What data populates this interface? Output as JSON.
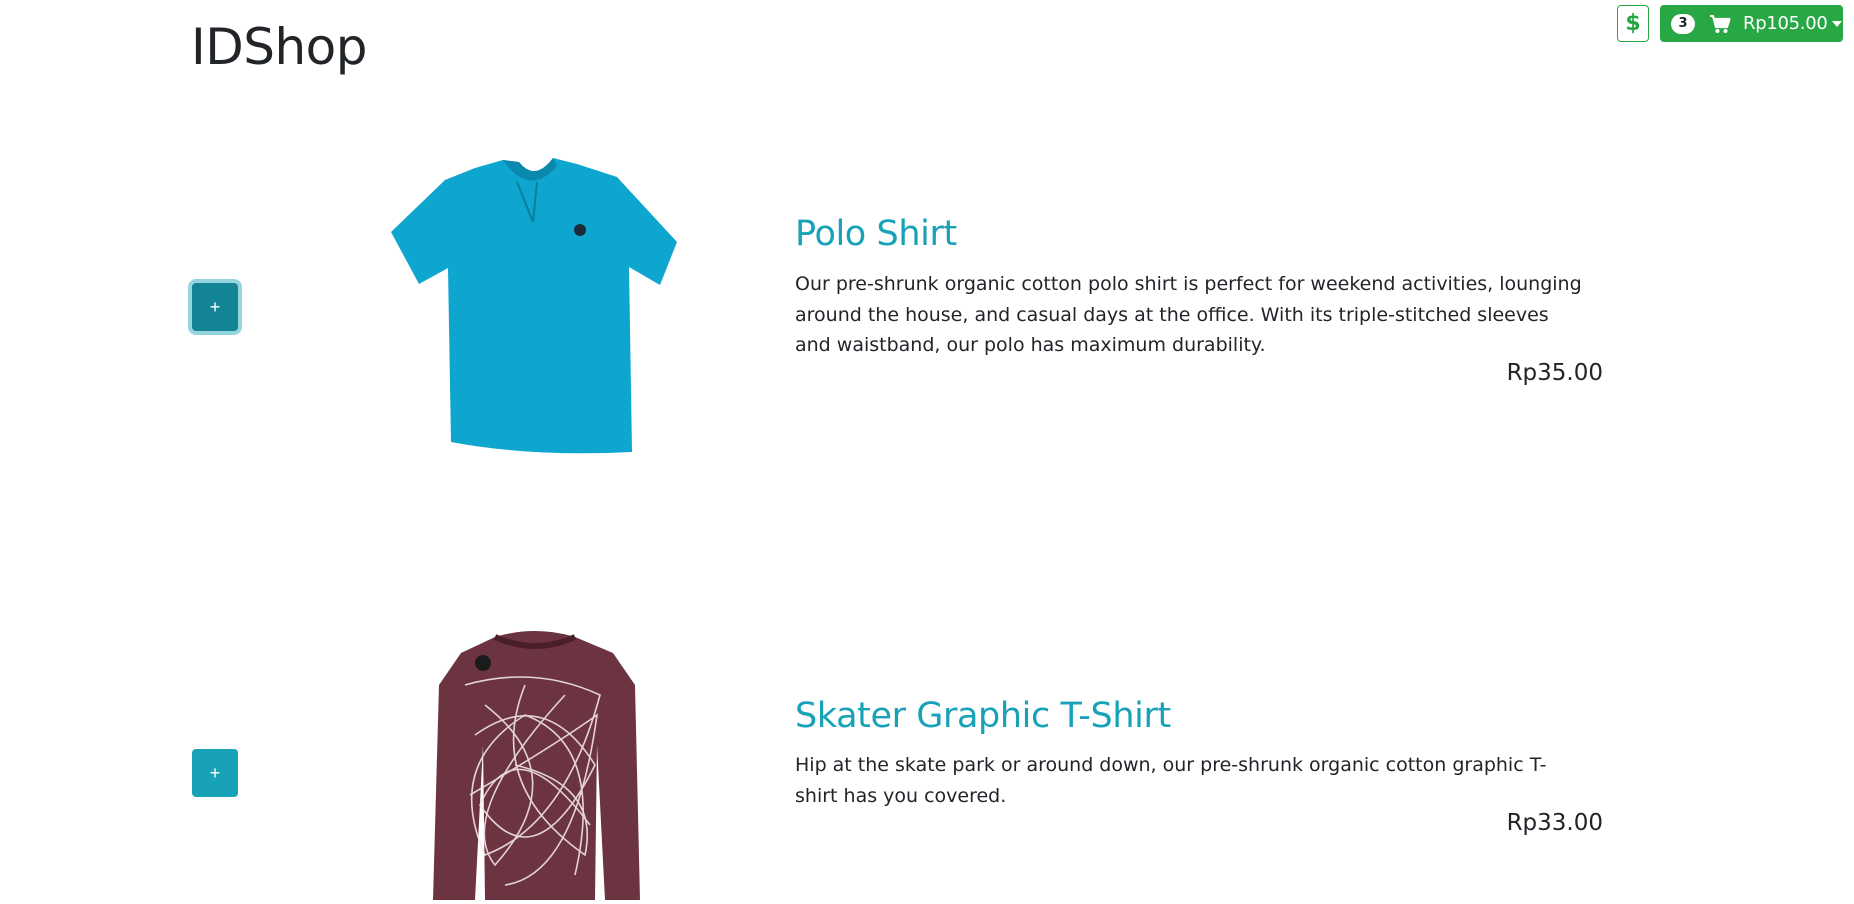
{
  "app": {
    "title": "IDShop"
  },
  "header": {
    "currency_icon": "$",
    "cart": {
      "count": "3",
      "total": "Rp105.00",
      "icon": "cart-icon"
    }
  },
  "products": [
    {
      "name": "Polo Shirt",
      "description": "Our pre-shrunk organic cotton polo shirt is perfect for weekend activities, lounging around the house, and casual days at the office. With its triple-stitched sleeves and waistband, our polo has maximum durability.",
      "price": "Rp35.00",
      "add_label": "+",
      "image_color": "#0ea5cf"
    },
    {
      "name": "Skater Graphic T-Shirt",
      "description": "Hip at the skate park or around down, our pre-shrunk organic cotton graphic T-shirt has you covered.",
      "price": "Rp33.00",
      "add_label": "+",
      "image_color": "#6b3440"
    }
  ],
  "colors": {
    "accent": "#17a2b8",
    "success": "#28a745"
  }
}
